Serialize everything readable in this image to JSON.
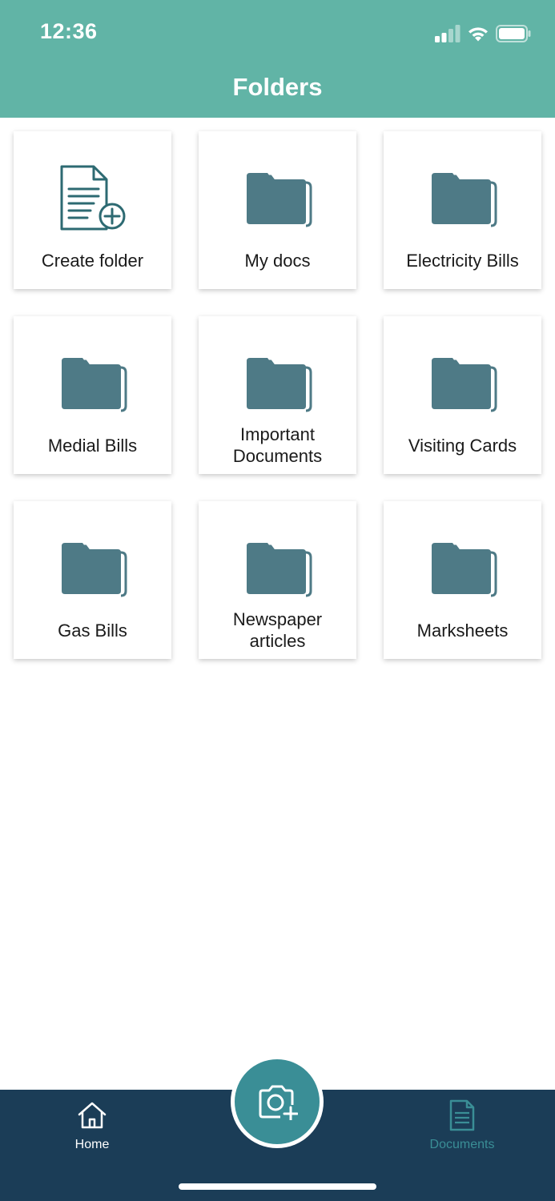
{
  "status_bar": {
    "time": "12:36",
    "icons": [
      "cellular-signal-icon",
      "wifi-icon",
      "battery-icon"
    ]
  },
  "header": {
    "title": "Folders"
  },
  "folders": [
    {
      "label": "Create folder",
      "icon": "create-folder-icon"
    },
    {
      "label": "My docs",
      "icon": "folder-icon"
    },
    {
      "label": "Electricity Bills",
      "icon": "folder-icon"
    },
    {
      "label": "Medial Bills",
      "icon": "folder-icon"
    },
    {
      "label": "Important\nDocuments",
      "icon": "folder-icon"
    },
    {
      "label": "Visiting Cards",
      "icon": "folder-icon"
    },
    {
      "label": "Gas Bills",
      "icon": "folder-icon"
    },
    {
      "label": "Newspaper\narticles",
      "icon": "folder-icon"
    },
    {
      "label": "Marksheets",
      "icon": "folder-icon"
    }
  ],
  "tabbar": {
    "home_label": "Home",
    "documents_label": "Documents",
    "fab_icon": "add-photo-camera-icon",
    "active_tab": "Home"
  },
  "colors": {
    "header": "#61b4a6",
    "folder": "#4e7a86",
    "tabbar": "#1b3d57",
    "fab": "#3a8e96",
    "inactive_tab": "#3a8e96"
  }
}
